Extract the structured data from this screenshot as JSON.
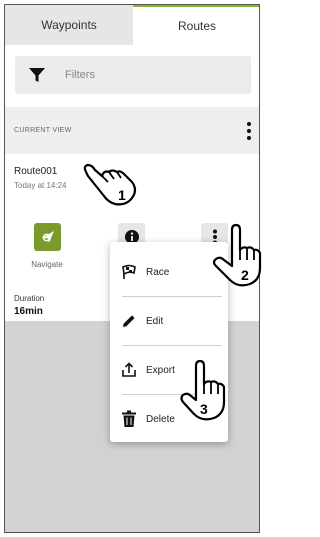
{
  "tabs": [
    {
      "label": "Waypoints",
      "active": false
    },
    {
      "label": "Routes",
      "active": true
    }
  ],
  "filter": {
    "placeholder": "Filters",
    "icon": "filter-icon"
  },
  "current_view": {
    "title": "CURRENT VIEW",
    "menu_icon": "more-vertical-icon"
  },
  "route": {
    "name": "Route001",
    "date": "Today at 14:24",
    "actions": {
      "navigate_label": "Navigate",
      "navigate_icon": "navigate-arrow-icon",
      "info_icon": "info-icon",
      "more_icon": "more-vertical-icon"
    },
    "duration_label": "Duration",
    "duration_value": "16min"
  },
  "context_menu": {
    "items": [
      {
        "label": "Race",
        "icon": "race-flag-icon"
      },
      {
        "label": "Edit",
        "icon": "pencil-icon"
      },
      {
        "label": "Export",
        "icon": "export-icon"
      },
      {
        "label": "Delete",
        "icon": "trash-icon"
      }
    ]
  },
  "annotations": {
    "step1": "1",
    "step2": "2",
    "step3": "3"
  },
  "colors": {
    "accent": "#8bb43a",
    "navigate_button": "#7a9a2c",
    "panel_background": "#d2d2d2"
  }
}
